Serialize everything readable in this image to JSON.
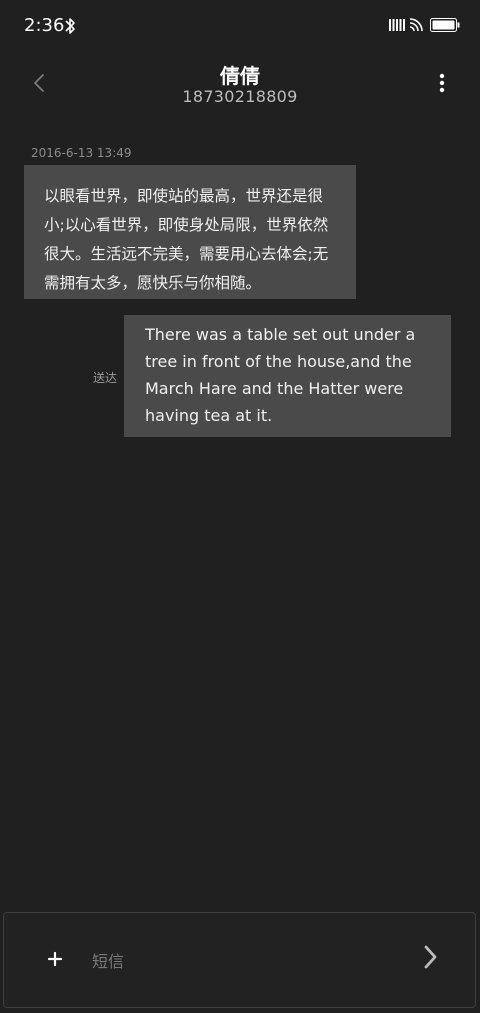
{
  "status_bar": {
    "time": "2:36",
    "icons": [
      "bluetooth-icon",
      "signal-icon",
      "wifi-icon",
      "battery-icon"
    ]
  },
  "header": {
    "contact_name": "倩倩",
    "contact_number": "18730218809",
    "icons": [
      "back-arrow-icon",
      "more-vertical-icon"
    ]
  },
  "conversation": {
    "timestamp": "2016-6-13 13:49",
    "messages": [
      {
        "direction": "incoming",
        "text": "以眼看世界，即使站的最高，世界还是很小;以心看世界，即使身处局限，世界依然很大。生活远不完美，需要用心去体会;无需拥有太多，愿快乐与你相随。"
      },
      {
        "direction": "outgoing",
        "text": "There was a table set out under a tree in front of the house,and the March Hare and the Hatter were having tea at it.",
        "status": "送达"
      }
    ]
  },
  "composer": {
    "placeholder": "短信",
    "value": "",
    "icons": [
      "plus-icon",
      "send-chevron-icon"
    ]
  },
  "colors": {
    "background": "#202020",
    "bubble": "#4a4a4a",
    "text": "#f0f0f0",
    "muted": "#8c8c8c"
  }
}
